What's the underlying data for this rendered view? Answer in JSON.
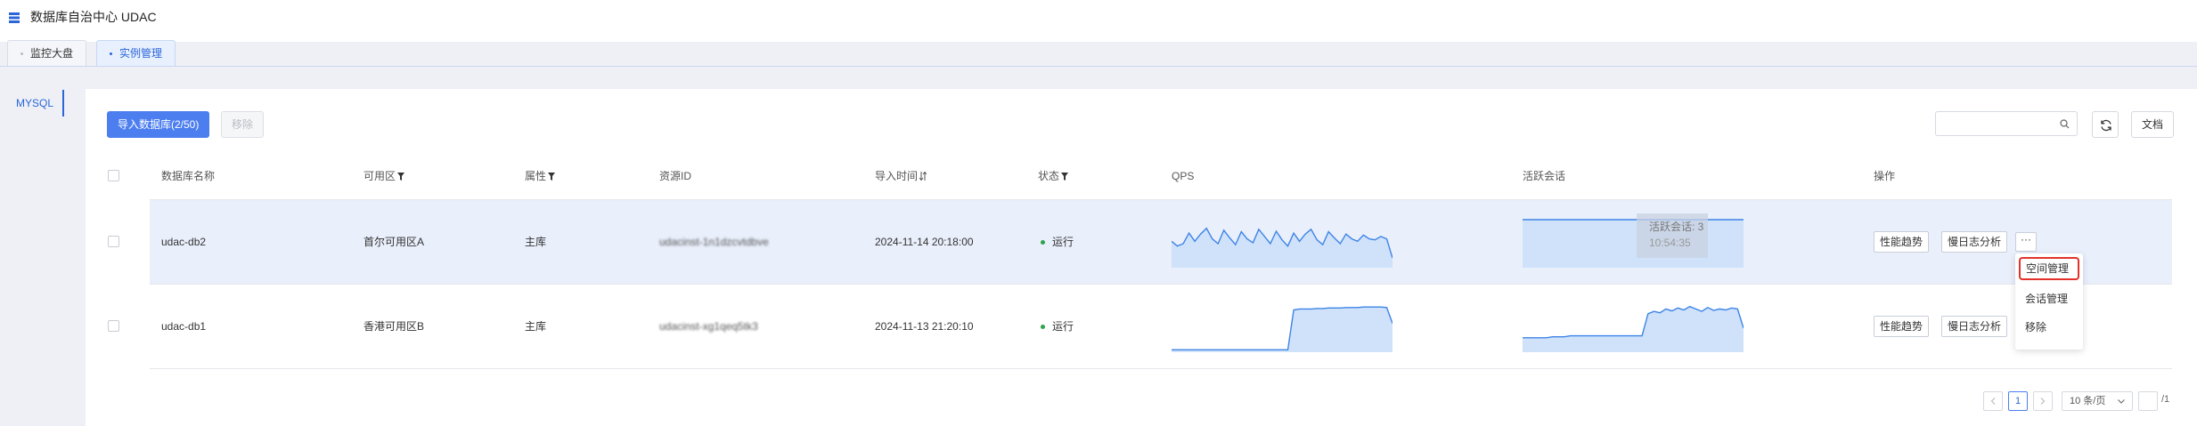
{
  "app": {
    "title": "数据库自治中心 UDAC",
    "logo_icon": "database-grid-icon"
  },
  "tabs": [
    {
      "label": "监控大盘",
      "active": false
    },
    {
      "label": "实例管理",
      "active": true
    }
  ],
  "sidebar": {
    "items": [
      {
        "label": "MYSQL",
        "active": true
      }
    ]
  },
  "toolbar": {
    "import_label": "导入数据库(2/50)",
    "remove_label": "移除",
    "search_placeholder": "",
    "docs_label": "文档",
    "refresh_icon": "refresh-icon"
  },
  "table": {
    "columns": {
      "name": "数据库名称",
      "zone": "可用区",
      "attr": "属性",
      "resource_id": "资源ID",
      "import_time": "导入时间",
      "status": "状态",
      "qps": "QPS",
      "sessions": "活跃会话",
      "actions": "操作"
    },
    "rows": [
      {
        "name": "udac-db2",
        "zone": "首尔可用区A",
        "attr": "主库",
        "resource_id": "udacinst-1n1dzcvtdbve",
        "import_time": "2024-11-14 20:18:00",
        "status": "运行",
        "qps_series": [
          0.55,
          0.45,
          0.5,
          0.72,
          0.55,
          0.7,
          0.82,
          0.6,
          0.5,
          0.78,
          0.62,
          0.48,
          0.75,
          0.6,
          0.52,
          0.8,
          0.65,
          0.5,
          0.76,
          0.58,
          0.45,
          0.72,
          0.55,
          0.7,
          0.8,
          0.58,
          0.48,
          0.75,
          0.62,
          0.5,
          0.7,
          0.6,
          0.55,
          0.68,
          0.6,
          0.58,
          0.65,
          0.6,
          0.2
        ],
        "session_series": [
          1,
          1,
          1,
          1,
          1,
          1,
          1,
          1,
          1,
          1,
          1,
          1,
          1,
          1,
          1,
          1,
          1,
          1,
          1,
          1,
          1
        ],
        "hovered": true
      },
      {
        "name": "udac-db1",
        "zone": "香港可用区B",
        "attr": "主库",
        "resource_id": "udacinst-xg1qeq5tk3",
        "import_time": "2024-11-13 21:20:10",
        "status": "运行",
        "qps_series": [
          0.05,
          0.05,
          0.05,
          0.05,
          0.05,
          0.05,
          0.05,
          0.05,
          0.05,
          0.05,
          0.05,
          0.05,
          0.05,
          0.05,
          0.05,
          0.05,
          0.05,
          0.05,
          0.05,
          0.05,
          0.05,
          0.88,
          0.9,
          0.9,
          0.9,
          0.91,
          0.91,
          0.92,
          0.92,
          0.92,
          0.93,
          0.93,
          0.93,
          0.94,
          0.94,
          0.94,
          0.94,
          0.93,
          0.6
        ],
        "session_series": [
          0.3,
          0.3,
          0.3,
          0.3,
          0.3,
          0.32,
          0.32,
          0.32,
          0.34,
          0.34,
          0.34,
          0.34,
          0.34,
          0.34,
          0.34,
          0.34,
          0.34,
          0.34,
          0.34,
          0.34,
          0.34,
          0.8,
          0.85,
          0.82,
          0.9,
          0.86,
          0.92,
          0.88,
          0.95,
          0.9,
          0.85,
          0.93,
          0.87,
          0.9,
          0.88,
          0.92,
          0.9,
          0.5
        ],
        "hovered": false
      }
    ],
    "action_labels": {
      "trend": "性能趋势",
      "slowlog": "慢日志分析",
      "more": "···"
    }
  },
  "tooltip": {
    "line1": "活跃会话: 3",
    "line2": "10:54:35"
  },
  "dropdown": {
    "items": [
      "空间管理",
      "会话管理",
      "移除"
    ],
    "highlighted_index": 0
  },
  "pagination": {
    "prev_icon": "chevron-left-icon",
    "next_icon": "chevron-right-icon",
    "current_page": "1",
    "page_size": "10 条/页",
    "total": "/1"
  },
  "colors": {
    "accent": "#4c7ef0",
    "chart_line": "#3d84e6",
    "chart_fill": "#cfe2fa",
    "status_running": "#2fa24a",
    "highlight": "#e2322b"
  }
}
